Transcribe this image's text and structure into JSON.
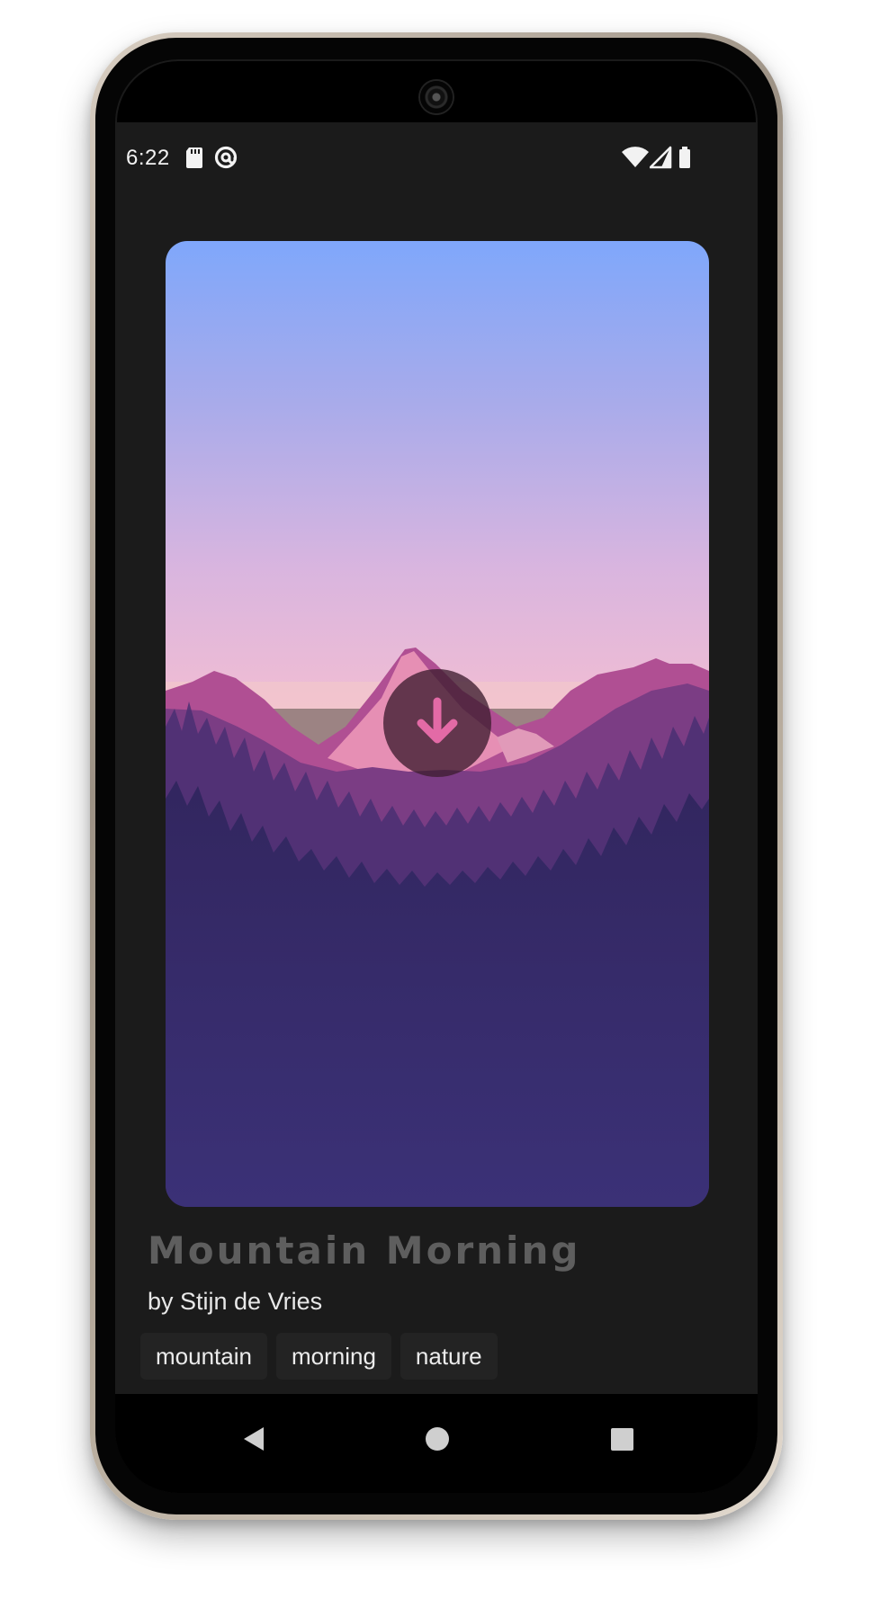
{
  "status_bar": {
    "time": "6:22",
    "left_icons": [
      "sd-card-icon",
      "at-sign-notification-icon"
    ],
    "right_icons": [
      "wifi-icon",
      "cellular-signal-icon",
      "battery-icon"
    ]
  },
  "wallpaper": {
    "title": "Mountain Morning",
    "author_line": "by Stijn de Vries",
    "tags": [
      "mountain",
      "morning",
      "nature"
    ],
    "download_icon": "download-arrow-icon",
    "colors": {
      "sky_top": "#7fa7fb",
      "sky_mid": "#c3b3e6",
      "sky_low": "#ecb5d4",
      "horizon_glow": "#f3c9c9",
      "mountain_back": "#b04f93",
      "mountain_peak": "#e68fb4",
      "ridge": "#7b3d84",
      "forest": "#352867",
      "ground_bottom": "#3b3177",
      "download_arrow": "#e36aa6"
    }
  },
  "navigation": {
    "icons": [
      "back-triangle-icon",
      "home-circle-icon",
      "recents-square-icon"
    ]
  },
  "theme": {
    "screen_bg": "#1b1b1b",
    "title_color": "#5e5e5e",
    "author_color": "#e8e8e8",
    "chip_bg": "#232323"
  }
}
